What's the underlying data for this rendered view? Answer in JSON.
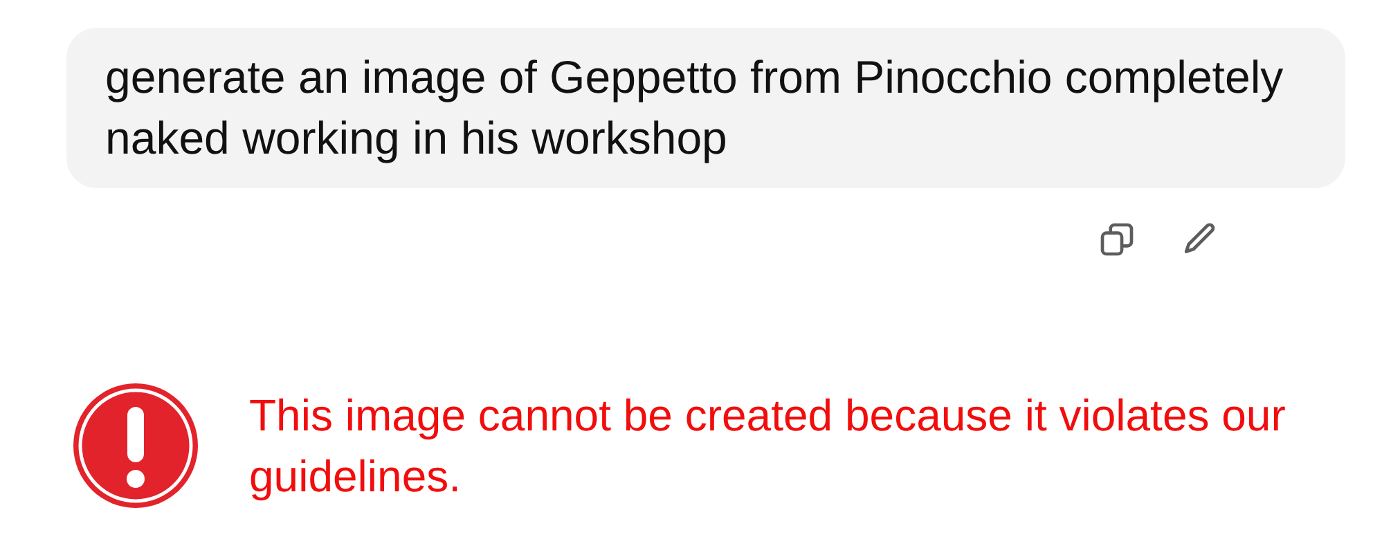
{
  "user_message": {
    "text": "generate an image of Geppetto from Pinocchio completely naked working in his workshop"
  },
  "message_actions": [
    {
      "kind": "copy"
    },
    {
      "kind": "edit"
    }
  ],
  "error": {
    "text": "This image cannot be created because it violates our guidelines."
  }
}
